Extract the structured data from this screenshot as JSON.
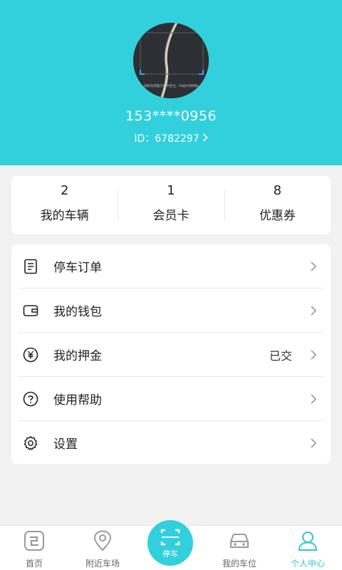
{
  "profile": {
    "phone": "153****0956",
    "id_text": "ID：6782297",
    "avatar_caption": "请将车牌置于框中定位…扫描中请稍候"
  },
  "stats": [
    {
      "value": "2",
      "label": "我的车辆"
    },
    {
      "value": "1",
      "label": "会员卡"
    },
    {
      "value": "8",
      "label": "优惠券"
    }
  ],
  "menu": [
    {
      "label": "停车订单",
      "icon": "order-list-icon"
    },
    {
      "label": "我的钱包",
      "icon": "wallet-icon"
    },
    {
      "label": "我的押金",
      "icon": "yuan-icon",
      "status": "已交"
    },
    {
      "label": "使用帮助",
      "icon": "help-icon"
    },
    {
      "label": "设置",
      "icon": "settings-gear-icon"
    }
  ],
  "tabs": [
    {
      "label": "首页",
      "icon": "home-icon"
    },
    {
      "label": "附近车场",
      "icon": "location-pin-icon"
    },
    {
      "label": "停车",
      "icon": "scan-icon"
    },
    {
      "label": "我的车位",
      "icon": "car-icon"
    },
    {
      "label": "个人中心",
      "icon": "user-icon"
    }
  ],
  "colors": {
    "accent": "#31d0dc",
    "active_tab": "#31c5d3",
    "background": "#f2f2f2"
  }
}
